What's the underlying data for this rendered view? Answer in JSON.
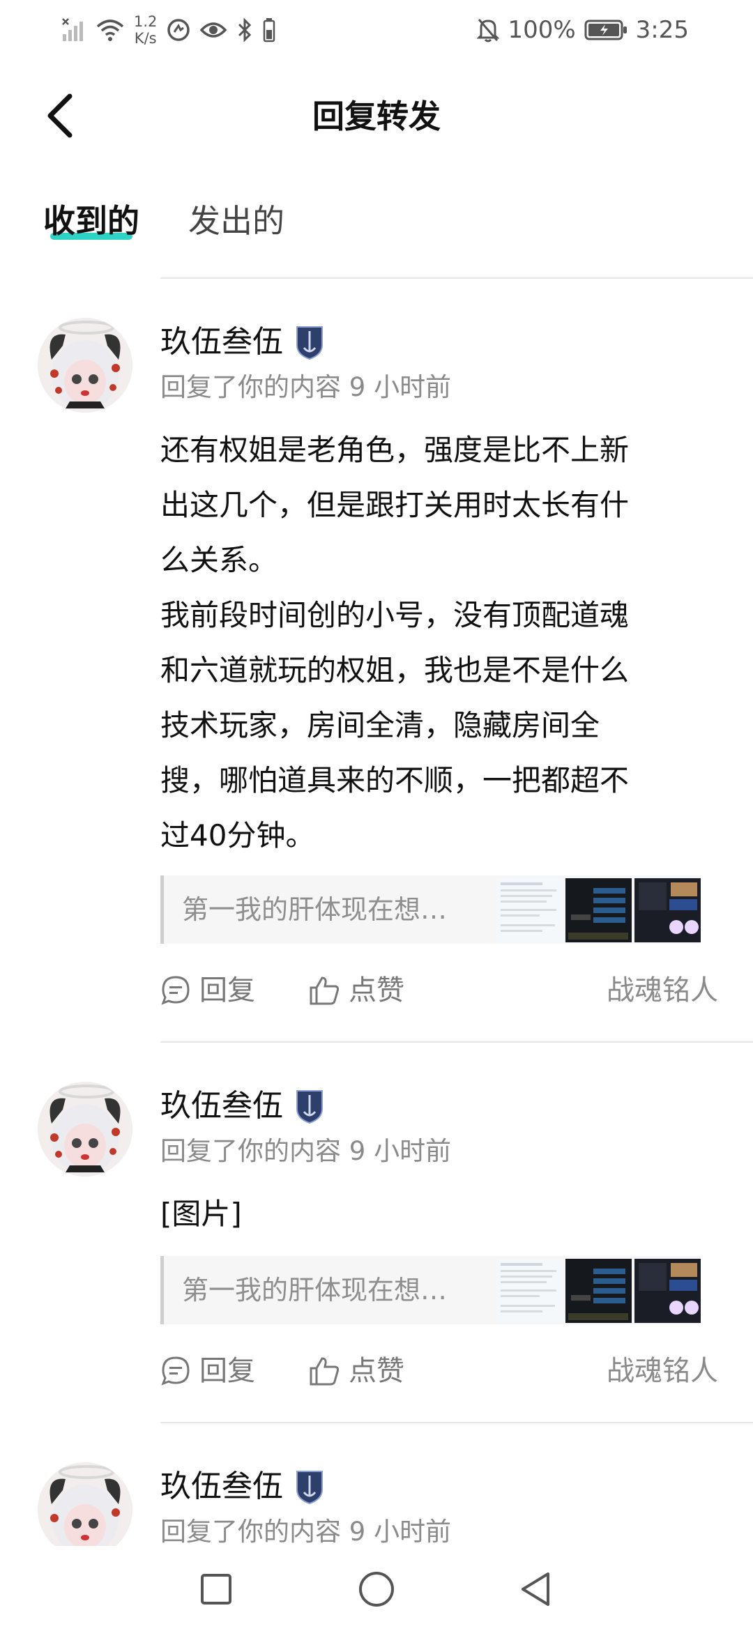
{
  "status_bar": {
    "network_speed_value": "1.2",
    "network_speed_unit": "K/s",
    "battery_percent": "100%",
    "time": "3:25"
  },
  "header": {
    "title": "回复转发"
  },
  "tabs": [
    {
      "label": "收到的",
      "active": true
    },
    {
      "label": "发出的",
      "active": false
    }
  ],
  "items": [
    {
      "username": "玖伍叁伍",
      "meta": "回复了你的内容 9 小时前",
      "content_lines": [
        "还有权姐是老角色，强度是比不上新",
        "出这几个，但是跟打关用时太长有什",
        "么关系。",
        "我前段时间创的小号，没有顶配道魂",
        "和六道就玩的权姐，我也是不是什么",
        "技术玩家，房间全清，隐藏房间全",
        "搜，哪怕道具来的不顺，一把都超不",
        "过40分钟。"
      ],
      "quote": "第一我的肝体现在想…",
      "reply_label": "回复",
      "like_label": "点赞",
      "tag": "战魂铭人"
    },
    {
      "username": "玖伍叁伍",
      "meta": "回复了你的内容 9 小时前",
      "content_lines": [
        "[图片]"
      ],
      "quote": "第一我的肝体现在想…",
      "reply_label": "回复",
      "like_label": "点赞",
      "tag": "战魂铭人"
    },
    {
      "username": "玖伍叁伍",
      "meta": "回复了你的内容 9 小时前"
    }
  ],
  "colors": {
    "accent": "#2dd4c5",
    "badge": "#2f3f6b"
  }
}
